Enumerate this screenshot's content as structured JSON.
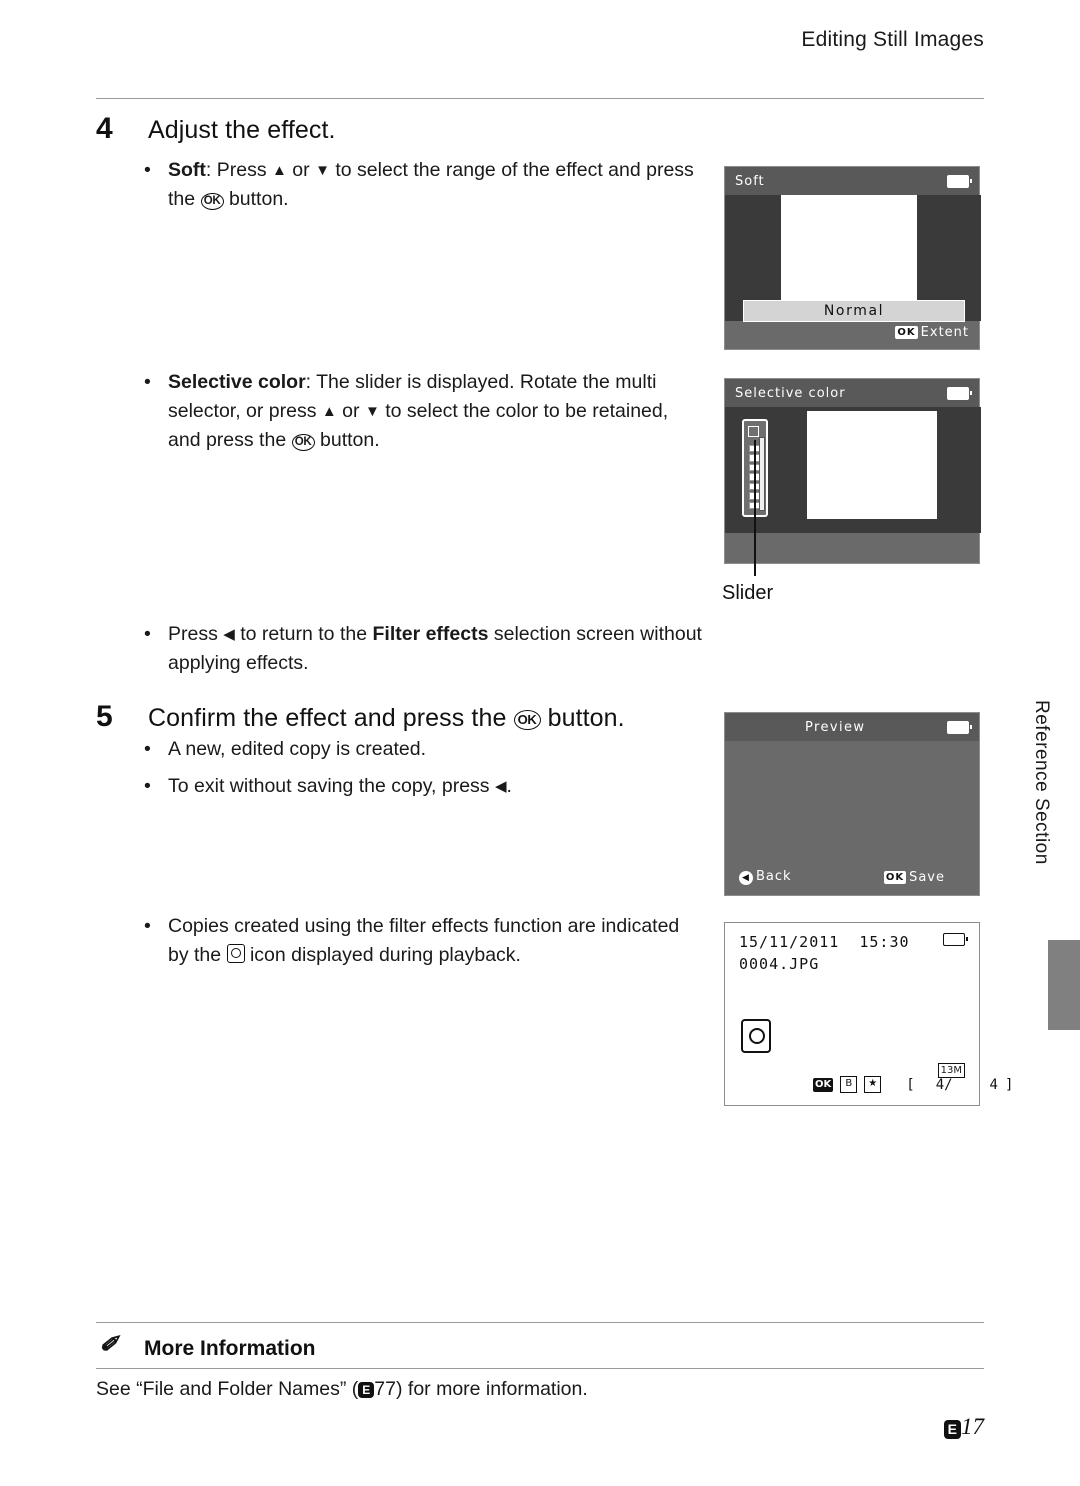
{
  "header": {
    "title": "Editing Still Images"
  },
  "steps": [
    {
      "number": "4",
      "title": "Adjust the effect.",
      "bullets": [
        {
          "id": "soft",
          "lead": "Soft",
          "rest_1": ": Press ",
          "rest_2": " or ",
          "rest_3": " to select the range of the effect and press the ",
          "rest_4": " button."
        },
        {
          "id": "selective-color",
          "lead": "Selective color",
          "rest_1": ": The slider is displayed. Rotate the multi selector, or press ",
          "rest_2": " or ",
          "rest_3": " to select the color to be retained, and press the ",
          "rest_4": " button."
        },
        {
          "id": "return",
          "pre": "Press ",
          "mid": " to return to the ",
          "strong": "Filter effects",
          "post": " selection screen without applying effects."
        }
      ]
    },
    {
      "number": "5",
      "title_pre": "Confirm the effect and press the ",
      "title_post": " button.",
      "bullets": [
        {
          "text": "A new, edited copy is created."
        },
        {
          "text_pre": "To exit without saving the copy, press ",
          "text_post": "."
        },
        {
          "text_pre": "Copies created using the filter effects function are indicated by the ",
          "text_post": " icon displayed during playback."
        }
      ]
    }
  ],
  "screens": {
    "soft": {
      "title": "Soft",
      "normal_label": "Normal",
      "extent_label": "Extent",
      "extent_key": "OK"
    },
    "selective_color": {
      "title": "Selective color",
      "slider_caption": "Slider"
    },
    "preview": {
      "title": "Preview",
      "back_label": "Back",
      "save_label": "Save",
      "save_key": "OK"
    },
    "playback": {
      "date": "15/11/2011",
      "time": "15:30",
      "filename": "0004.JPG",
      "resolution": "13M",
      "ok_key": "OK",
      "star_key": "B",
      "counter_left": "4/",
      "counter_right": "4"
    }
  },
  "side_tab": {
    "label": "Reference Section"
  },
  "more_information": {
    "title": "More Information",
    "icon": "pencil-icon",
    "text_pre": "See “File and Folder Names” (",
    "chip": "E",
    "chip_num": "77",
    "text_post": ") for more information."
  },
  "footer": {
    "page_chip": "E",
    "page_num": "17"
  },
  "glyphs": {
    "ok": "OK",
    "arrow_up": "▲",
    "arrow_down": "▼",
    "arrow_left": "◀"
  }
}
